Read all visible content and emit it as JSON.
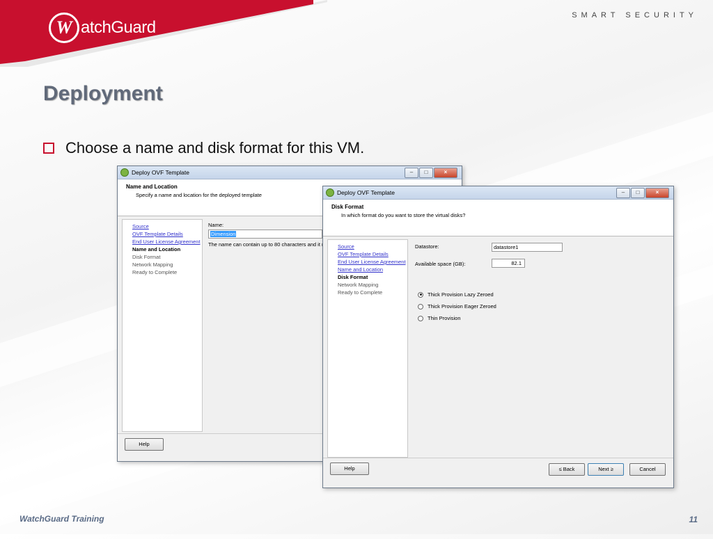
{
  "brand": {
    "logo_mark": "W",
    "logo_text": "atchGuard",
    "tagline": "SMART SECURITY",
    "accent_color": "#c8102e"
  },
  "slide": {
    "title": "Deployment",
    "bullet": "Choose a name and disk format for this VM."
  },
  "footer": {
    "left": "WatchGuard Training",
    "page_number": "11"
  },
  "dialog1": {
    "title": "Deploy OVF Template",
    "header_title": "Name and Location",
    "header_sub": "Specify a name and location for the deployed template",
    "nav": {
      "source": "Source",
      "ovf_details": "OVF Template Details",
      "eula": "End User License Agreement",
      "name_location": "Name and Location",
      "disk_format": "Disk Format",
      "network_mapping": "Network Mapping",
      "ready": "Ready to Complete"
    },
    "name_label": "Name:",
    "name_value": "Dimension",
    "name_hint": "The name can contain up to 80 characters and it m",
    "help": "Help"
  },
  "dialog2": {
    "title": "Deploy OVF Template",
    "header_title": "Disk Format",
    "header_sub": "In which format do you want to store the virtual disks?",
    "nav": {
      "source": "Source",
      "ovf_details": "OVF Template Details",
      "eula": "End User License Agreement",
      "name_location": "Name and Location",
      "disk_format": "Disk Format",
      "network_mapping": "Network Mapping",
      "ready": "Ready to Complete"
    },
    "datastore_label": "Datastore:",
    "datastore_value": "datastore1",
    "space_label": "Available space (GB):",
    "space_value": "82.1",
    "options": {
      "thick_lazy": "Thick Provision Lazy Zeroed",
      "thick_eager": "Thick Provision Eager Zeroed",
      "thin": "Thin Provision"
    },
    "selected_option": "Thick Provision Lazy Zeroed",
    "help": "Help",
    "back": "≤ Back",
    "next": "Next ≥",
    "cancel": "Cancel"
  }
}
